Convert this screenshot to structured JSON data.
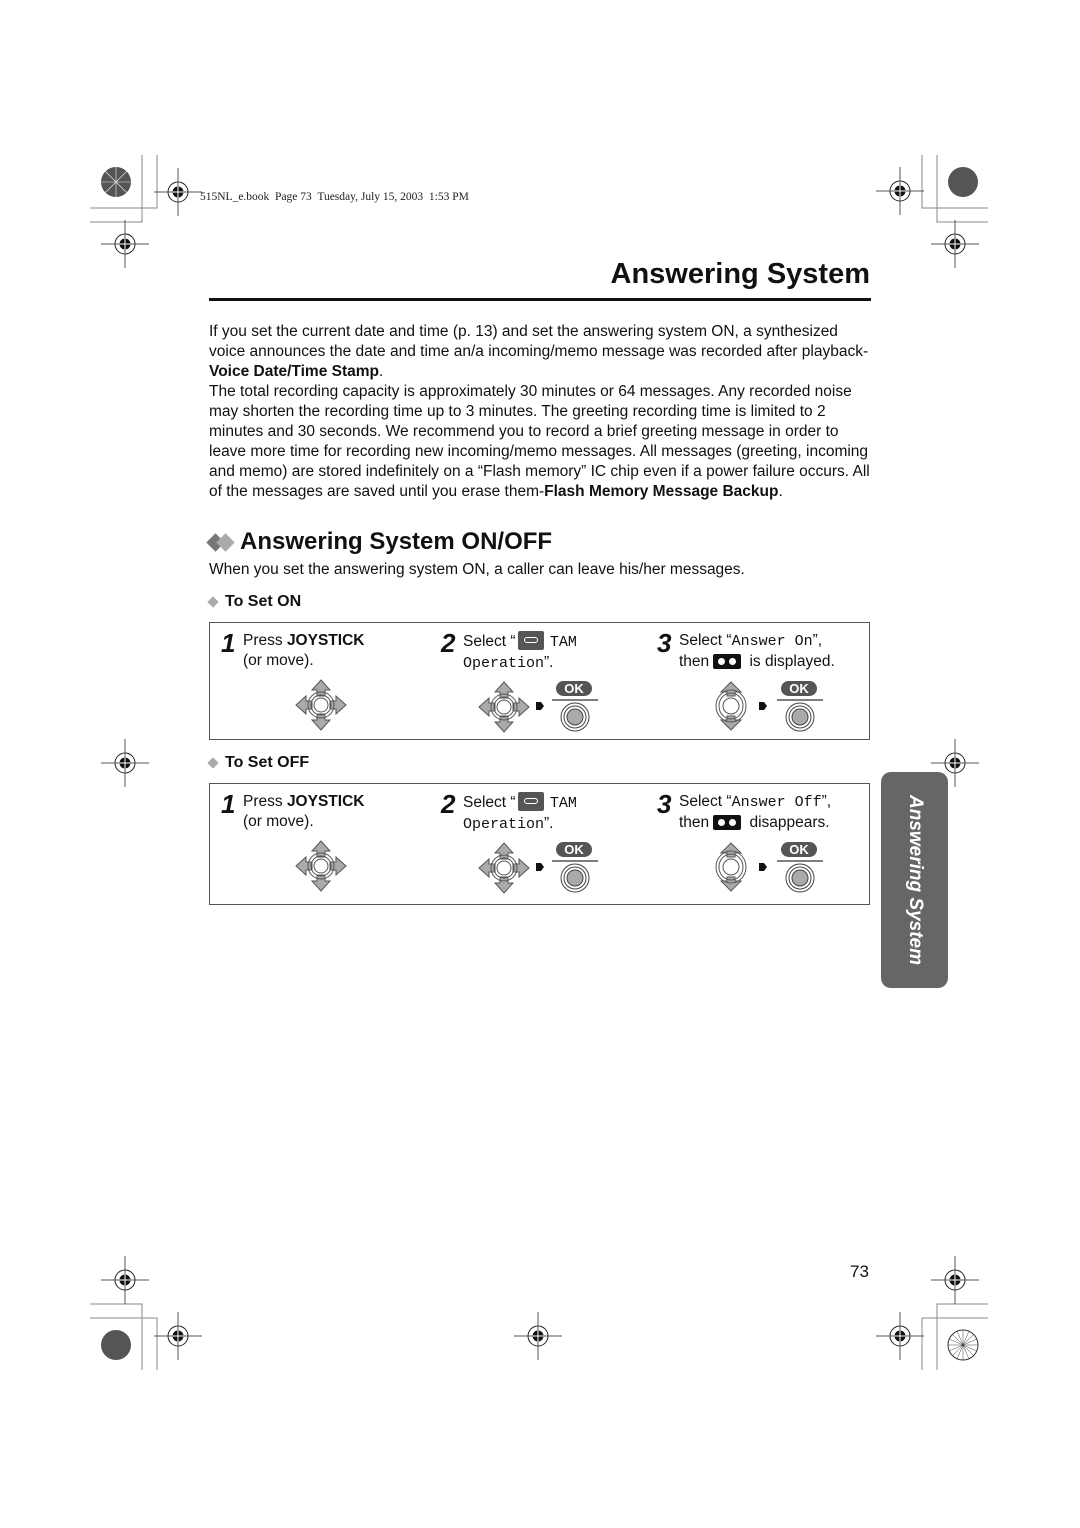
{
  "header_meta": "515NL_e.book  Page 73  Tuesday, July 15, 2003  1:53 PM",
  "page_title": "Answering System",
  "intro": {
    "p1_text": "If you set the current date and time (p. 13) and set the answering system ON, a synthesized voice announces the date and time an/a incoming/memo message was recorded after playback-",
    "p1_bold": "Voice Date/Time Stamp",
    "p1_end": ".",
    "p2_text": "The total recording capacity is approximately 30 minutes or 64 messages. Any recorded noise may shorten the recording time up to 3 minutes. The greeting recording time is limited to 2 minutes and 30 seconds. We recommend you to record a brief greeting message in order to leave more time for recording new incoming/memo messages. All messages (greeting, incoming and memo) are stored indefinitely on a “Flash memory” IC chip even if a power failure occurs. All of the messages are saved until you erase them-",
    "p2_bold": "Flash Memory Message Backup",
    "p2_end": "."
  },
  "section": {
    "title": "Answering System ON/OFF",
    "intro": "When you set the answering system ON, a caller can leave his/her messages."
  },
  "procedures": [
    {
      "heading": "To Set ON",
      "steps": [
        {
          "num": "1",
          "pre": "Press ",
          "bold": "JOYSTICK",
          "line2": "(or move)."
        },
        {
          "num": "2",
          "pre": "Select “",
          "mono1": "TAM",
          "mono2": "Operation",
          "post": "”."
        },
        {
          "num": "3",
          "pre": "Select “",
          "mono": "Answer On",
          "post": "”,",
          "line2_pre": "then",
          "line2_post": "is displayed."
        }
      ]
    },
    {
      "heading": "To Set OFF",
      "steps": [
        {
          "num": "1",
          "pre": "Press ",
          "bold": "JOYSTICK",
          "line2": "(or move)."
        },
        {
          "num": "2",
          "pre": "Select “",
          "mono1": "TAM",
          "mono2": "Operation",
          "post": "”."
        },
        {
          "num": "3",
          "pre": "Select “",
          "mono": "Answer Off",
          "post": "”,",
          "line2_pre": "then",
          "line2_post": "disappears."
        }
      ]
    }
  ],
  "ok_label": "OK",
  "side_tab": "Answering System",
  "page_number": "73",
  "colors": {
    "tab_bg": "#666666",
    "joystick_gray": "#a8a8a8",
    "ok_badge": "#555555"
  }
}
